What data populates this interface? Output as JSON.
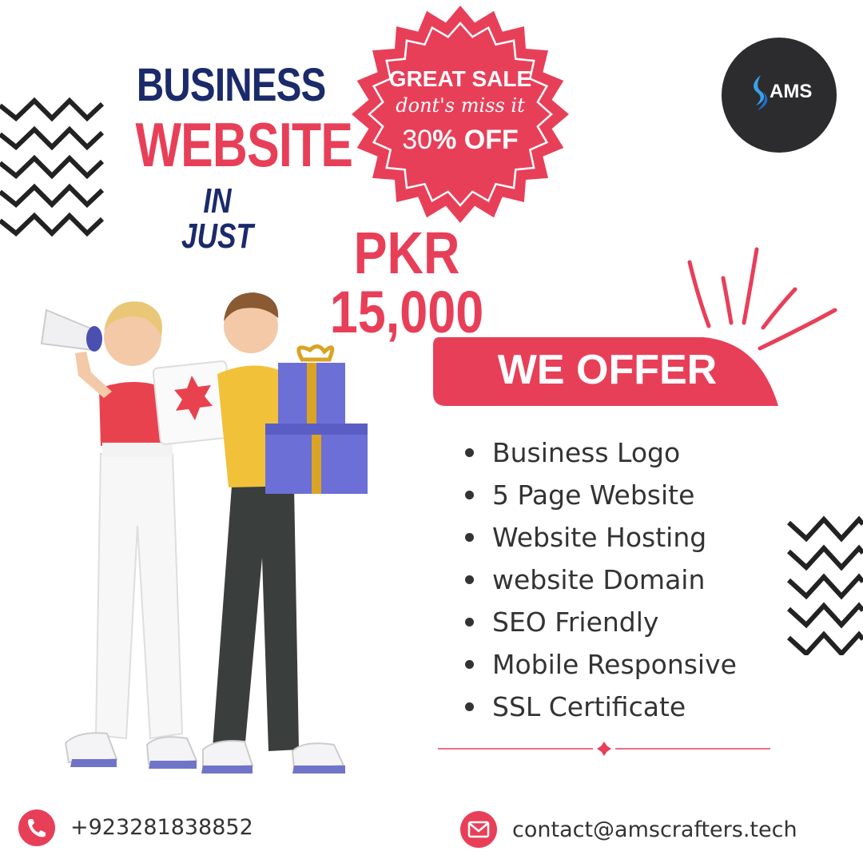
{
  "headline": {
    "line1": "BUSINESS",
    "line2": "WEBSITE",
    "line3": "IN JUST",
    "price": "PKR 15,000"
  },
  "badge": {
    "line1": "GREAT SALE",
    "line2": "dont's miss it",
    "discount_number": "30",
    "discount_suffix": "% OFF"
  },
  "logo": {
    "text": "AMS"
  },
  "offer": {
    "title": "WE OFFER",
    "items": [
      "Business Logo",
      "5 Page Website",
      "Website Hosting",
      "website Domain",
      "SEO Friendly",
      "Mobile Responsive",
      "SSL Certificate"
    ]
  },
  "contact": {
    "phone": "+923281838852",
    "email": "contact@amscrafters.tech"
  },
  "icons": {
    "phone": "phone-icon",
    "email": "mail-icon",
    "logo_mark": "flame-icon"
  },
  "colors": {
    "accent": "#e83f59",
    "navy": "#1b2a6b",
    "dark": "#2c2c2e",
    "text": "#333333"
  }
}
